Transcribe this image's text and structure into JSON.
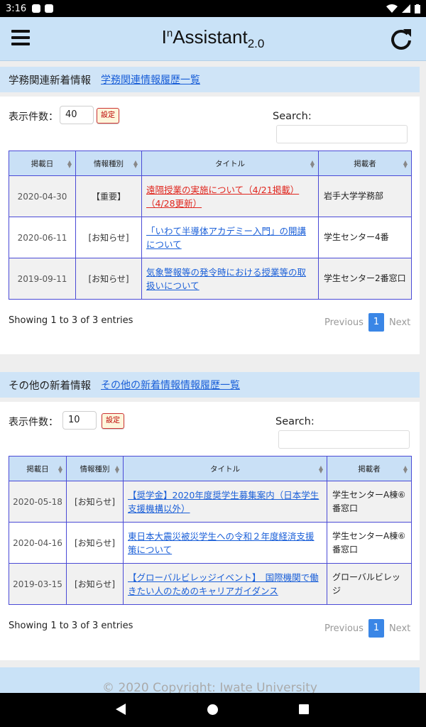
{
  "status_bar": {
    "time": "3:16"
  },
  "app_bar": {
    "title_prefix": "I",
    "title_sup": "n",
    "title_main": "Assistant",
    "title_sub": "2.0"
  },
  "labels": {
    "count_label": "表示件数：",
    "set_button": "設定",
    "search_label": "Search:",
    "previous": "Previous",
    "next": "Next"
  },
  "academic": {
    "heading": "学務関連新着情報",
    "history_link": "学務関連情報履歴一覧",
    "count_value": "40",
    "columns": [
      "掲載日",
      "情報種別",
      "タイトル",
      "掲載者"
    ],
    "rows": [
      {
        "date": "2020-04-30",
        "kind": "【重要】",
        "title": "遠隔授業の実施について（4/21掲載）（4/28更新）",
        "publisher": "岩手大学学務部"
      },
      {
        "date": "2020-06-11",
        "kind": "[お知らせ]",
        "title": "「いわて半導体アカデミー入門」の開講について",
        "publisher": "学生センター4番"
      },
      {
        "date": "2019-09-11",
        "kind": "[お知らせ]",
        "title": "気象警報等の発令時における授業等の取扱いについて",
        "publisher": "学生センター2番窓口"
      }
    ],
    "showing": "Showing 1 to 3 of 3 entries",
    "page": "1"
  },
  "other": {
    "heading": "その他の新着情報",
    "history_link": "その他の新着情報情報履歴一覧",
    "count_value": "10",
    "columns": [
      "掲載日",
      "情報種別",
      "タイトル",
      "掲載者"
    ],
    "rows": [
      {
        "date": "2020-05-18",
        "kind": "[お知らせ]",
        "title": "【奨学金】2020年度奨学生募集案内（日本学生支援機構以外）",
        "publisher": "学生センターA棟⑥番窓口"
      },
      {
        "date": "2020-04-16",
        "kind": "[お知らせ]",
        "title": "東日本大震災被災学生への令和２年度経済支援策について",
        "publisher": "学生センターA棟⑥番窓口"
      },
      {
        "date": "2019-03-15",
        "kind": "[お知らせ]",
        "title": "【グローバルビレッジイベント】　国際機関で働きたい人のためのキャリアガイダンス",
        "publisher": "グローバルビレッジ"
      }
    ],
    "showing": "Showing 1 to 3 of 3 entries",
    "page": "1"
  },
  "footer": {
    "copyright": "© 2020 Copyright: Iwate University"
  }
}
